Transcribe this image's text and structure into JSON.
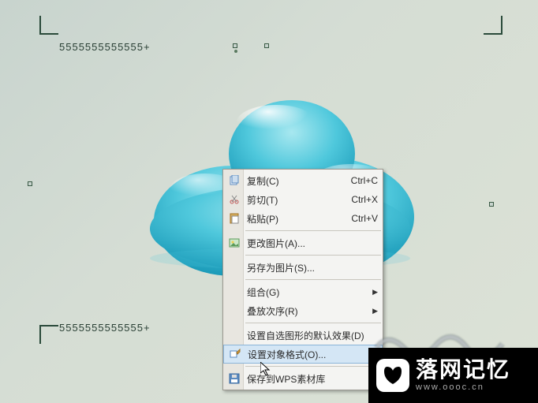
{
  "canvas": {
    "text_top": "5555555555555+",
    "text_bottom": "5555555555555+"
  },
  "context_menu": {
    "items": [
      {
        "icon": "copy-icon",
        "label": "复制(C)",
        "shortcut": "Ctrl+C"
      },
      {
        "icon": "cut-icon",
        "label": "剪切(T)",
        "shortcut": "Ctrl+X"
      },
      {
        "icon": "paste-icon",
        "label": "粘贴(P)",
        "shortcut": "Ctrl+V"
      }
    ],
    "items2": [
      {
        "icon": "change-pic-icon",
        "label": "更改图片(A)...",
        "shortcut": ""
      }
    ],
    "items3": [
      {
        "icon": "",
        "label": "另存为图片(S)...",
        "shortcut": ""
      }
    ],
    "items4": [
      {
        "icon": "",
        "label": "组合(G)",
        "submenu": true
      },
      {
        "icon": "",
        "label": "叠放次序(R)",
        "submenu": true
      }
    ],
    "items5": [
      {
        "icon": "",
        "label": "设置自选图形的默认效果(D)"
      },
      {
        "icon": "format-icon",
        "label": "设置对象格式(O)...",
        "selected": true
      }
    ],
    "items6": [
      {
        "icon": "save-lib-icon",
        "label": "保存到WPS素材库"
      }
    ]
  },
  "watermark": {
    "title": "落网记忆",
    "url": "www.oooc.cn"
  }
}
